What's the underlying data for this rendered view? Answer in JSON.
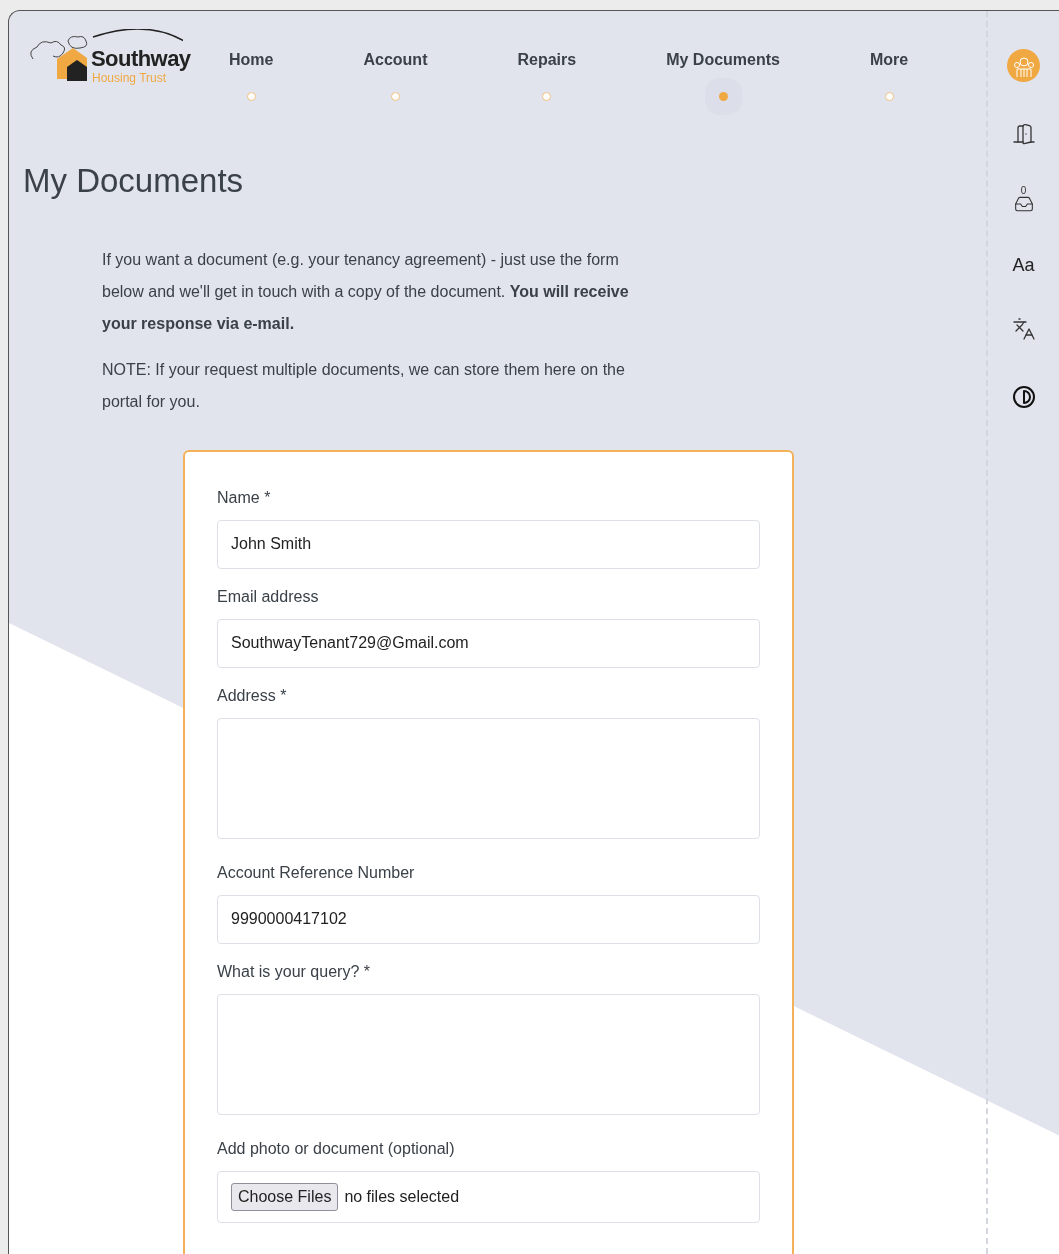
{
  "logo": {
    "name": "Southway",
    "tagline": "Housing Trust"
  },
  "nav": [
    {
      "label": "Home",
      "selected": false
    },
    {
      "label": "Account",
      "selected": false
    },
    {
      "label": "Repairs",
      "selected": false
    },
    {
      "label": "My Documents",
      "selected": true
    },
    {
      "label": "More",
      "selected": false
    }
  ],
  "sidebar": {
    "inbox_count": "0",
    "text_size_label": "Aa"
  },
  "page_title": "My Documents",
  "intro": [
    "If you want a document (e.g. your tenancy agreement) - just use the form below and we'll get in touch with a copy of the document. **You will receive your response via e-mail.**",
    "NOTE: If your request multiple documents, we can store them here on the portal for you."
  ],
  "form": {
    "fields": [
      {
        "kind": "text",
        "label": "Name *",
        "value": "John Smith"
      },
      {
        "kind": "text",
        "label": "Email address",
        "value": "SouthwayTenant729@Gmail.com"
      },
      {
        "kind": "textarea",
        "label": "Address *"
      },
      {
        "kind": "text",
        "label": "Account Reference Number",
        "value": "9990000417102"
      },
      {
        "kind": "textarea",
        "label": "What is your query? *"
      },
      {
        "kind": "file",
        "label": "Add photo or document (optional)",
        "button": "Choose Files",
        "status": "no files selected"
      }
    ]
  }
}
